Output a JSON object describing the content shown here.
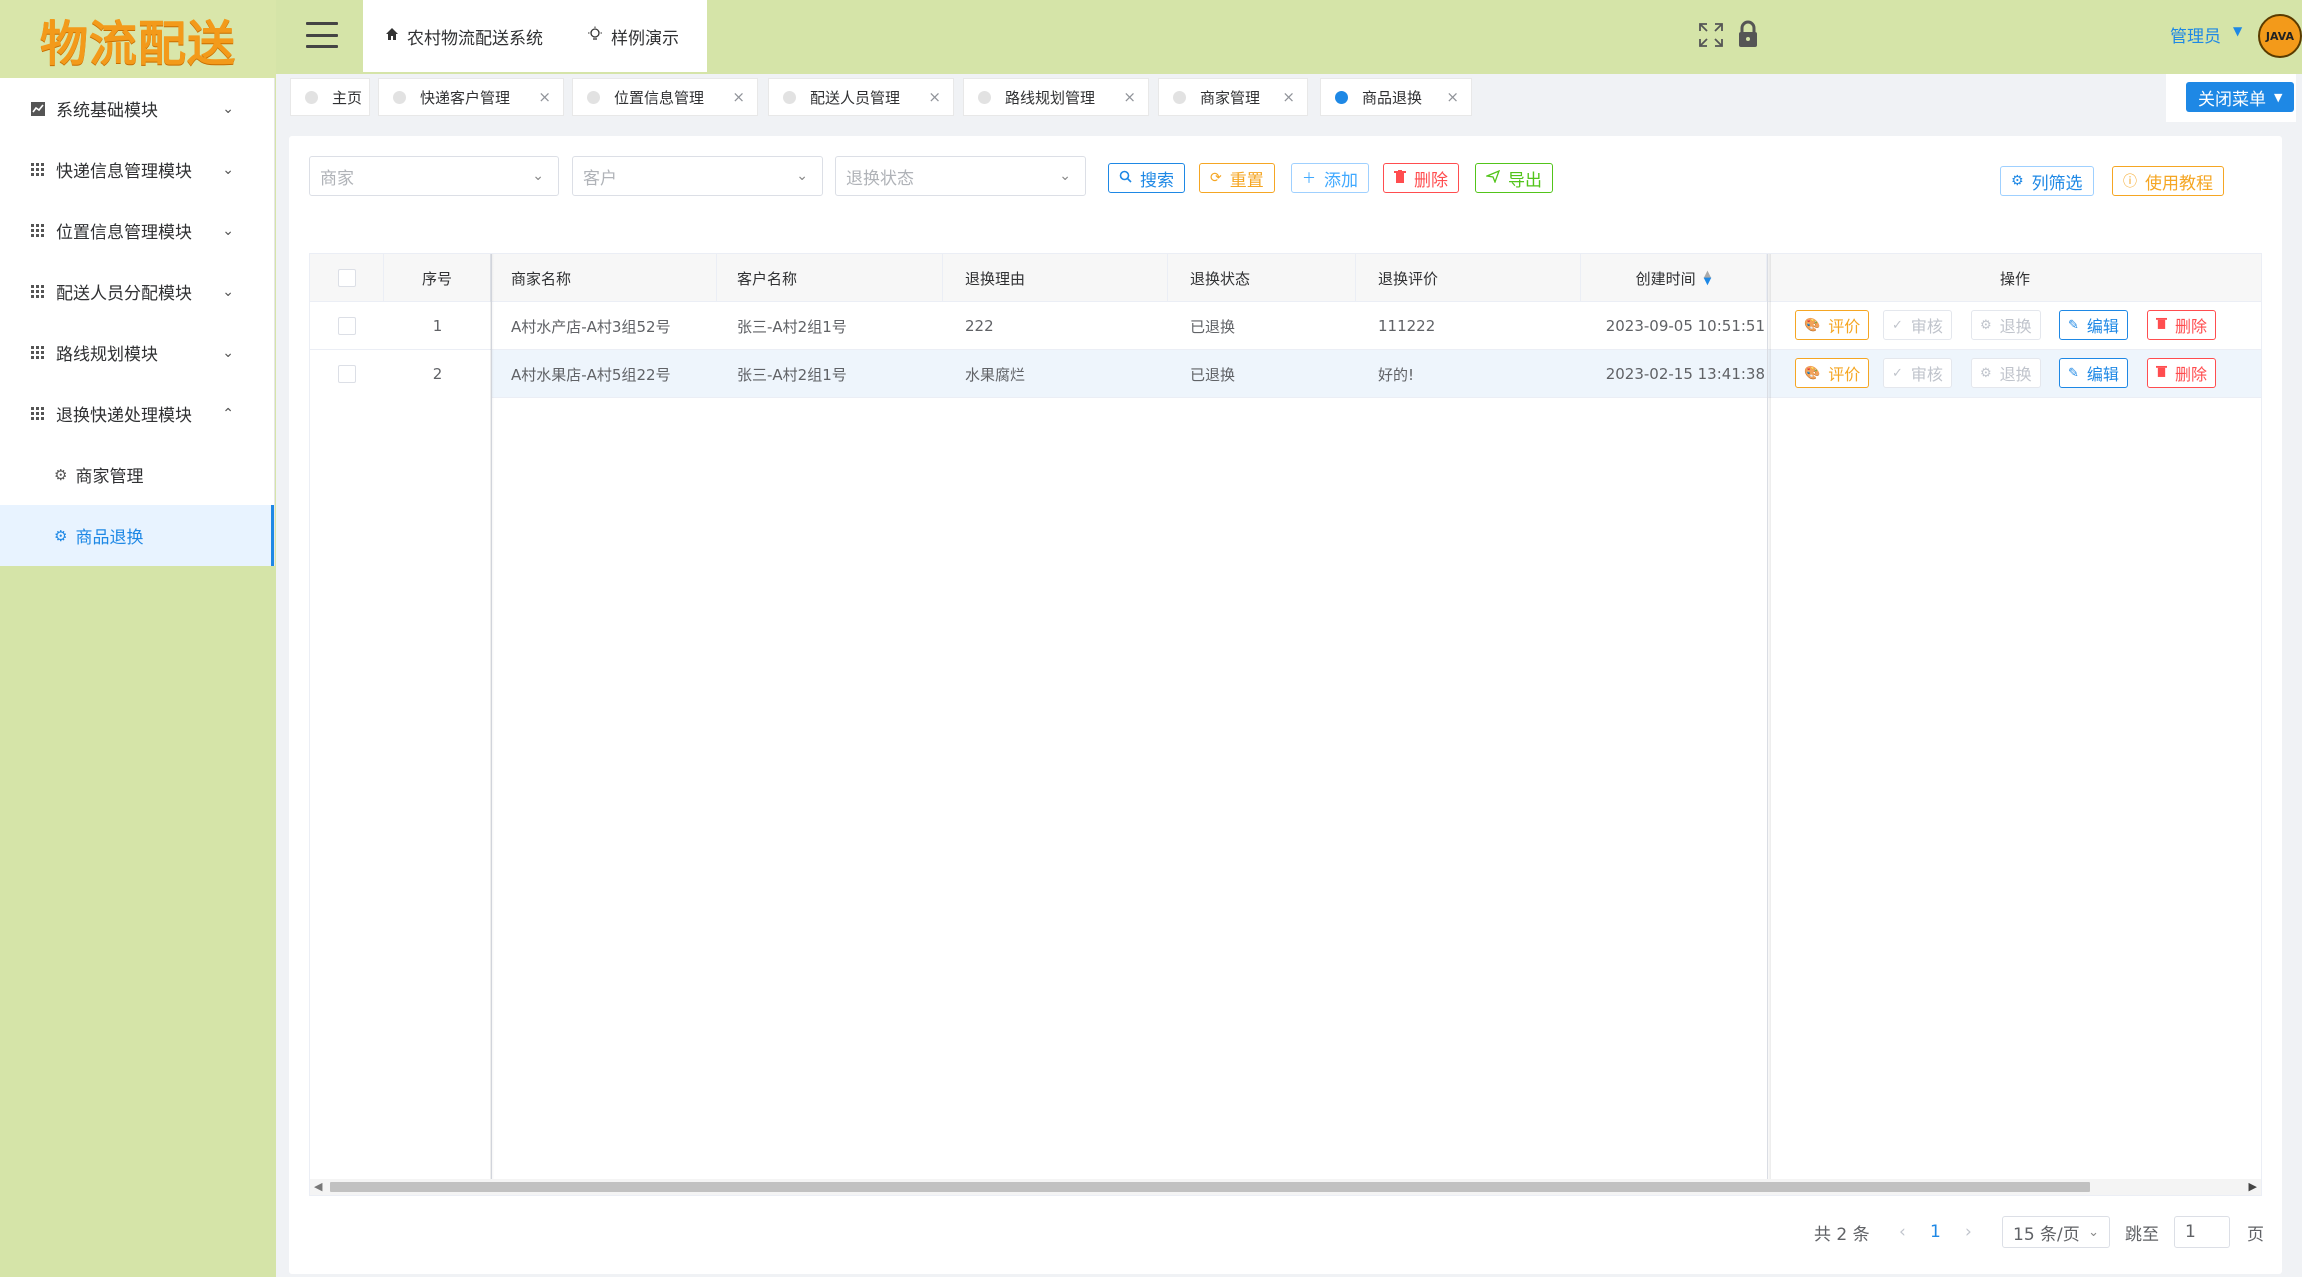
{
  "app": {
    "logo_text": "物流配送",
    "system_name": "农村物流配送系统",
    "demo_label": "样例演示",
    "user_name": "管理员",
    "avatar_text": "JAVA",
    "close_menu_label": "关闭菜单"
  },
  "sidebar": {
    "items": [
      {
        "label": "系统基础模块",
        "icon": "chart-icon"
      },
      {
        "label": "快递信息管理模块",
        "icon": "grid-icon"
      },
      {
        "label": "位置信息管理模块",
        "icon": "grid-icon"
      },
      {
        "label": "配送人员分配模块",
        "icon": "grid-icon"
      },
      {
        "label": "路线规划模块",
        "icon": "grid-icon"
      },
      {
        "label": "退换快递处理模块",
        "icon": "grid-icon"
      }
    ],
    "sub_items": [
      {
        "label": "商家管理"
      },
      {
        "label": "商品退换"
      }
    ]
  },
  "tabs": [
    {
      "label": "主页"
    },
    {
      "label": "快递客户管理"
    },
    {
      "label": "位置信息管理"
    },
    {
      "label": "配送人员管理"
    },
    {
      "label": "路线规划管理"
    },
    {
      "label": "商家管理"
    },
    {
      "label": "商品退换"
    }
  ],
  "filters": {
    "merchant_placeholder": "商家",
    "customer_placeholder": "客户",
    "status_placeholder": "退换状态"
  },
  "toolbar": {
    "search": "搜索",
    "reset": "重置",
    "add": "添加",
    "delete": "删除",
    "export": "导出",
    "column_filter": "列筛选",
    "tutorial": "使用教程"
  },
  "table": {
    "headers": [
      "序号",
      "商家名称",
      "客户名称",
      "退换理由",
      "退换状态",
      "退换评价",
      "创建时间",
      "操作"
    ],
    "rows": [
      {
        "index": "1",
        "merchant": "A村水产店-A村3组52号",
        "customer": "张三-A村2组1号",
        "reason": "222",
        "status": "已退换",
        "evaluation": "111222",
        "created": "2023-09-05 10:51:51"
      },
      {
        "index": "2",
        "merchant": "A村水果店-A村5组22号",
        "customer": "张三-A村2组1号",
        "reason": "水果腐烂",
        "status": "已退换",
        "evaluation": "好的!",
        "created": "2023-02-15 13:41:38"
      }
    ],
    "ops": {
      "evaluate": "评价",
      "review": "审核",
      "exchange": "退换",
      "edit": "编辑",
      "delete": "删除"
    }
  },
  "pagination": {
    "total": "共 2 条",
    "current_page": "1",
    "page_size": "15 条/页",
    "jump_label": "跳至",
    "jump_value": "1",
    "page_suffix": "页"
  }
}
